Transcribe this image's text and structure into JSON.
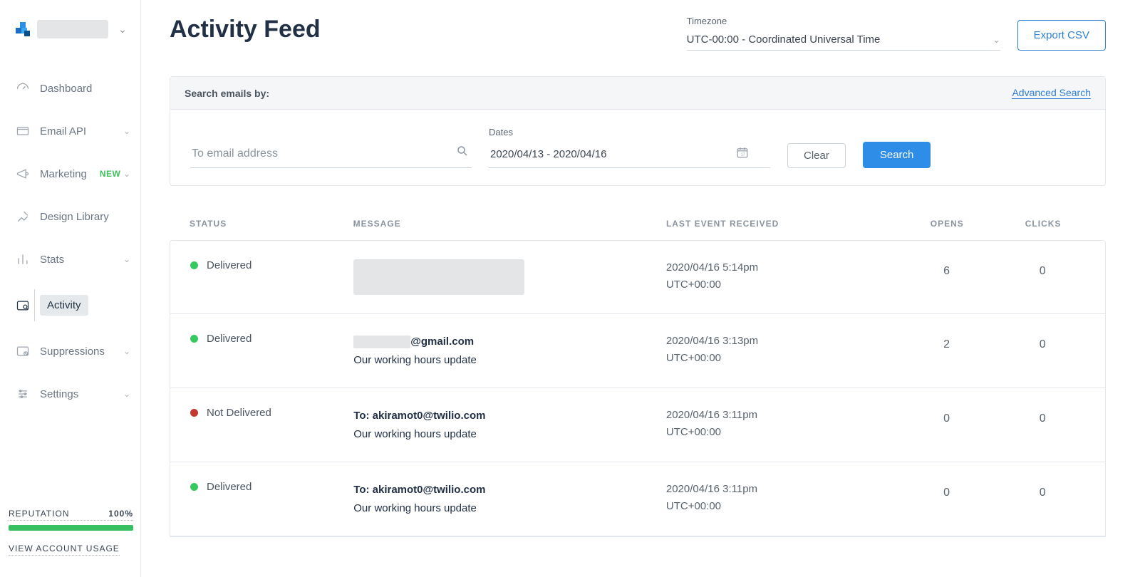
{
  "page_title": "Activity Feed",
  "timezone": {
    "label": "Timezone",
    "value": "UTC-00:00 - Coordinated Universal Time"
  },
  "export_label": "Export CSV",
  "sidebar": {
    "items": [
      {
        "label": "Dashboard",
        "icon": "dashboard-icon"
      },
      {
        "label": "Email API",
        "icon": "email-api-icon",
        "expandable": true
      },
      {
        "label": "Marketing",
        "icon": "marketing-icon",
        "expandable": true,
        "badge": "NEW"
      },
      {
        "label": "Design Library",
        "icon": "design-library-icon"
      },
      {
        "label": "Stats",
        "icon": "stats-icon",
        "expandable": true
      },
      {
        "label": "Activity",
        "icon": "activity-icon",
        "active": true
      },
      {
        "label": "Suppressions",
        "icon": "suppressions-icon",
        "expandable": true
      },
      {
        "label": "Settings",
        "icon": "settings-icon",
        "expandable": true
      }
    ],
    "reputation": {
      "label": "REPUTATION",
      "percent": "100%"
    },
    "usage_link": "VIEW ACCOUNT USAGE"
  },
  "search": {
    "head": "Search emails by:",
    "advanced": "Advanced Search",
    "email_placeholder": "To email address",
    "dates_label": "Dates",
    "dates_value": "2020/04/13 - 2020/04/16",
    "clear": "Clear",
    "search": "Search"
  },
  "table": {
    "columns": {
      "status": "STATUS",
      "message": "MESSAGE",
      "evt": "LAST EVENT RECEIVED",
      "opens": "OPENS",
      "clicks": "CLICKS"
    },
    "rows": [
      {
        "status": "Delivered",
        "statusColor": "green",
        "msg_line1": "",
        "msg_line2": "",
        "redacted": true,
        "evt_line1": "2020/04/16 5:14pm",
        "evt_line2": "UTC+00:00",
        "opens": "6",
        "clicks": "0"
      },
      {
        "status": "Delivered",
        "statusColor": "green",
        "msg_line1_suffix": "@gmail.com",
        "msg_line2": "Our working hours update",
        "partial_redact": true,
        "evt_line1": "2020/04/16 3:13pm",
        "evt_line2": "UTC+00:00",
        "opens": "2",
        "clicks": "0"
      },
      {
        "status": "Not Delivered",
        "statusColor": "red",
        "msg_line1": "To: akiramot0@twilio.com",
        "msg_line2": "Our working hours update",
        "evt_line1": "2020/04/16 3:11pm",
        "evt_line2": "UTC+00:00",
        "opens": "0",
        "clicks": "0"
      },
      {
        "status": "Delivered",
        "statusColor": "green",
        "msg_line1": "To: akiramot0@twilio.com",
        "msg_line2": "Our working hours update",
        "evt_line1": "2020/04/16 3:11pm",
        "evt_line2": "UTC+00:00",
        "opens": "0",
        "clicks": "0"
      }
    ]
  }
}
